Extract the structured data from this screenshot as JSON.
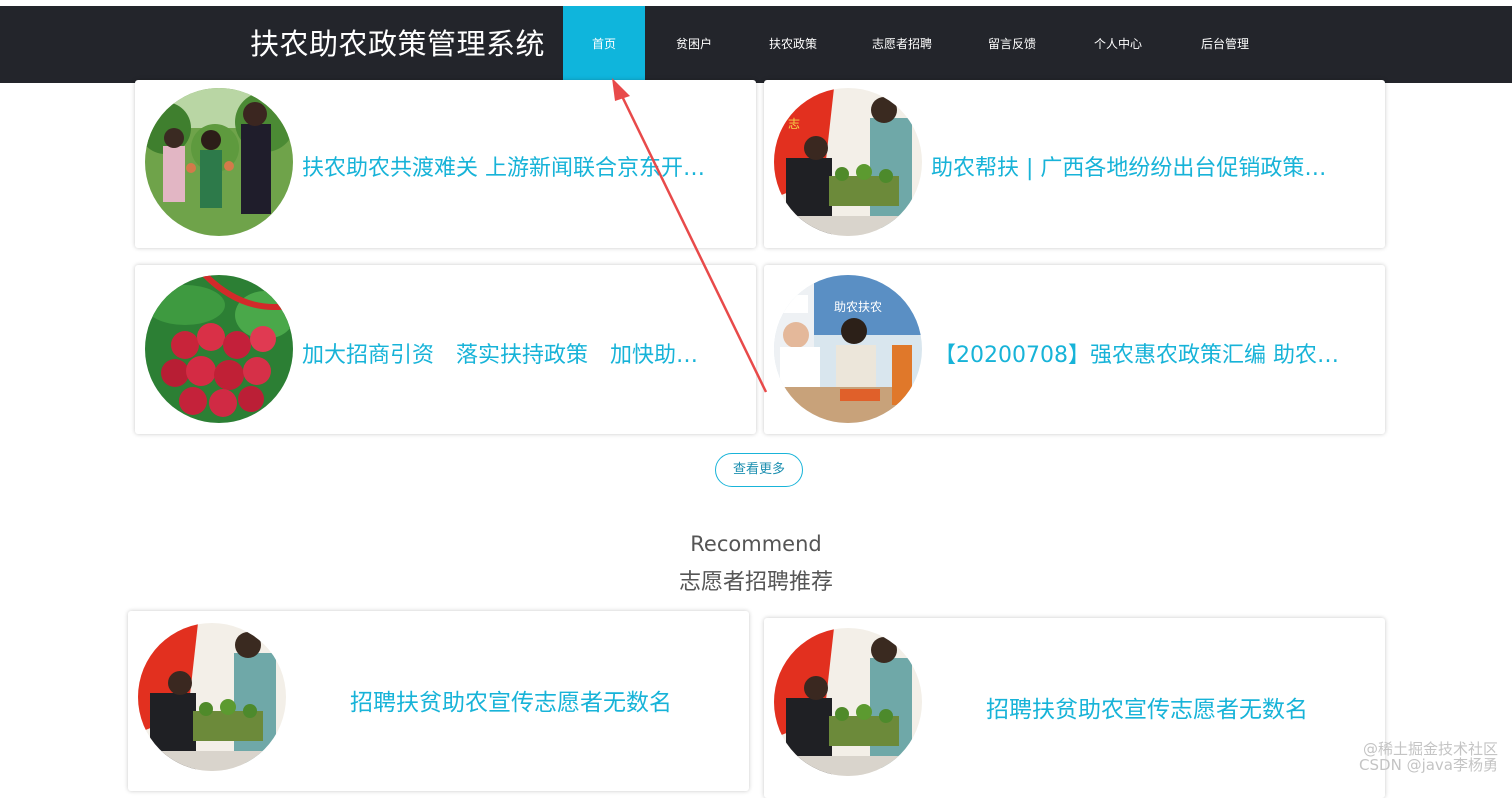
{
  "nav": {
    "brand": "扶农助农政策管理系统",
    "items": [
      {
        "label": "首页",
        "active": true
      },
      {
        "label": "贫困户",
        "active": false
      },
      {
        "label": "扶农政策",
        "active": false
      },
      {
        "label": "志愿者招聘",
        "active": false
      },
      {
        "label": "留言反馈",
        "active": false
      },
      {
        "label": "个人中心",
        "active": false
      },
      {
        "label": "后台管理",
        "active": false
      }
    ]
  },
  "news": [
    {
      "title": "扶农助农共渡难关 上游新闻联合京东开…"
    },
    {
      "title": "助农帮扶 | 广西各地纷纷出台促销政策…"
    },
    {
      "title": "加大招商引资　落实扶持政策　加快助…"
    },
    {
      "title": "【20200708】强农惠农政策汇编 助农…"
    }
  ],
  "more_label": "查看更多",
  "recommend": {
    "en": "Recommend",
    "cn": "志愿者招聘推荐"
  },
  "recruits": [
    {
      "title": "招聘扶贫助农宣传志愿者无数名"
    },
    {
      "title": "招聘扶贫助农宣传志愿者无数名"
    }
  ],
  "watermark": {
    "line1": "@稀土掘金技术社区",
    "line2": "CSDN @java李杨勇"
  },
  "colors": {
    "nav_bg": "#23252b",
    "accent": "#0fb5dc",
    "title_text": "#17b3d8",
    "arrow": "#e84a4a"
  }
}
